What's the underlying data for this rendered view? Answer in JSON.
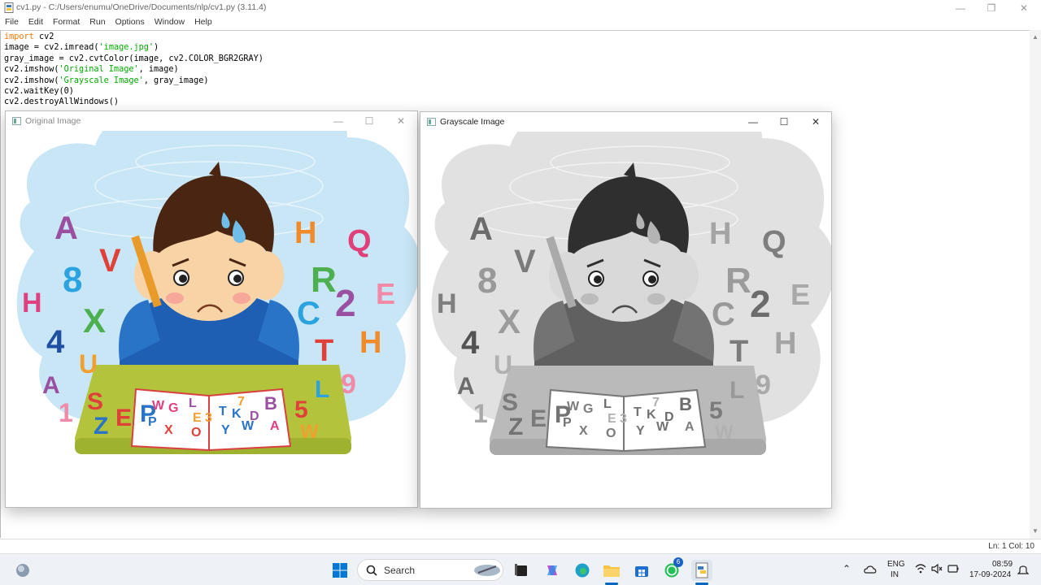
{
  "idle": {
    "title": "cv1.py - C:/Users/enumu/OneDrive/Documents/nlp/cv1.py (3.11.4)",
    "menu": [
      "File",
      "Edit",
      "Format",
      "Run",
      "Options",
      "Window",
      "Help"
    ],
    "code": {
      "l1_kw": "import",
      "l1_rest": " cv2",
      "l2_a": "image = cv2.imread(",
      "l2_s": "'image.jpg'",
      "l2_b": ")",
      "l3": "gray_image = cv2.cvtColor(image, cv2.COLOR_BGR2GRAY)",
      "l4_a": "cv2.imshow(",
      "l4_s": "'Original Image'",
      "l4_b": ", image)",
      "l5_a": "cv2.imshow(",
      "l5_s": "'Grayscale Image'",
      "l5_b": ", gray_image)",
      "l6": "cv2.waitKey(0)",
      "l7": "cv2.destroyAllWindows()"
    },
    "status": "Ln: 1   Col: 10"
  },
  "windows": {
    "original": {
      "title": "Original Image"
    },
    "gray": {
      "title": "Grayscale Image"
    }
  },
  "image": {
    "letters": [
      "A",
      "8",
      "V",
      "H",
      "X",
      "4",
      "U",
      "A",
      "1",
      "S",
      "H",
      "Q",
      "R",
      "E",
      "C",
      "2",
      "T",
      "H",
      "L",
      "9",
      "5",
      "W",
      "Z",
      "E",
      "P"
    ],
    "book_left": [
      "W",
      "G",
      "L",
      "P",
      "E",
      "3",
      "X",
      "O"
    ],
    "book_right": [
      "7",
      "B",
      "T",
      "K",
      "D",
      "Y",
      "W",
      "A"
    ]
  },
  "taskbar": {
    "search": "Search",
    "lang1": "ENG",
    "lang2": "IN",
    "time": "08:59",
    "date": "17-09-2024",
    "badge": "6"
  },
  "colors": {
    "keyword": "#ff7700",
    "string": "#00aa00",
    "accent": "#0067c0"
  }
}
